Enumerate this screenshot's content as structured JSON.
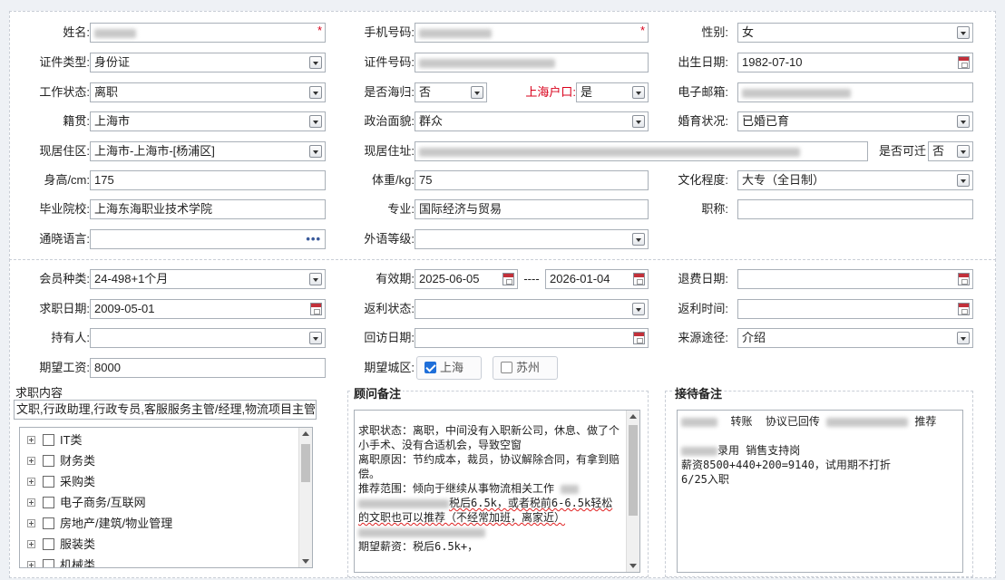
{
  "basic": {
    "name": {
      "label": "姓名:",
      "value": ""
    },
    "phone": {
      "label": "手机号码:",
      "value": ""
    },
    "gender": {
      "label": "性别:",
      "value": "女"
    },
    "id_type": {
      "label": "证件类型:",
      "value": "身份证"
    },
    "id_no": {
      "label": "证件号码:",
      "value": ""
    },
    "birth": {
      "label": "出生日期:",
      "value": "1982-07-10"
    },
    "work_status": {
      "label": "工作状态:",
      "value": "离职"
    },
    "overseas": {
      "label": "是否海归:",
      "value": "否"
    },
    "hukou": {
      "label": "上海户口:",
      "value": "是"
    },
    "email": {
      "label": "电子邮箱:",
      "value": ""
    },
    "native": {
      "label": "籍贯:",
      "value": "上海市"
    },
    "politics": {
      "label": "政治面貌:",
      "value": "群众"
    },
    "marital": {
      "label": "婚育状况:",
      "value": "已婚已育"
    },
    "residence": {
      "label": "现居住区:",
      "value": "上海市-上海市-[杨浦区]"
    },
    "address": {
      "label": "现居住址:",
      "value": ""
    },
    "relocate": {
      "label": "是否可迁",
      "value": "否"
    },
    "height": {
      "label": "身高/cm:",
      "value": "175"
    },
    "weight": {
      "label": "体重/kg:",
      "value": "75"
    },
    "education": {
      "label": "文化程度:",
      "value": "大专（全日制）"
    },
    "school": {
      "label": "毕业院校:",
      "value": "上海东海职业技术学院"
    },
    "major": {
      "label": "专业:",
      "value": "国际经济与贸易"
    },
    "title": {
      "label": "职称:",
      "value": ""
    },
    "language": {
      "label": "通晓语言:",
      "value": "",
      "more": "•••"
    },
    "foreign_level": {
      "label": "外语等级:",
      "value": ""
    }
  },
  "member": {
    "type": {
      "label": "会员种类:",
      "value": "24-498+1个月"
    },
    "valid": {
      "label": "有效期:",
      "start": "2025-06-05",
      "sep": "----",
      "end": "2026-01-04"
    },
    "refund_date": {
      "label": "退费日期:",
      "value": ""
    },
    "job_date": {
      "label": "求职日期:",
      "value": "2009-05-01"
    },
    "rebate_status": {
      "label": "返利状态:",
      "value": ""
    },
    "rebate_time": {
      "label": "返利时间:",
      "value": ""
    },
    "holder": {
      "label": "持有人:",
      "value": ""
    },
    "visit_date": {
      "label": "回访日期:",
      "value": ""
    },
    "source": {
      "label": "来源途径:",
      "value": "介绍"
    },
    "salary": {
      "label": "期望工资:",
      "value": "8000"
    },
    "city": {
      "label": "期望城区:",
      "options": [
        {
          "label": "上海",
          "checked": true
        },
        {
          "label": "苏州",
          "checked": false
        }
      ]
    }
  },
  "job_content": {
    "title": "求职内容",
    "summary": "文职,行政助理,行政专员,客服服务主管/经理,物流项目主管",
    "tree": [
      "IT类",
      "财务类",
      "采购类",
      "电子商务/互联网",
      "房地产/建筑/物业管理",
      "服装类",
      "机械类"
    ]
  },
  "advisor_note": {
    "title": "顾问备注",
    "lines": [
      "求职状态：离职，中间没有入职新公司，休息、做了个小手术、没有合适机会，导致空窗",
      "离职原因：节约成本，裁员，协议解除合同，有拿到赔偿。",
      "推荐范围：倾向于继续从事物流相关工作",
      "税后6.5k，或者税前6-6.5k轻松的文职也可以推荐（不经常加班，离家近）",
      "期望薪资：税后6.5k+，"
    ]
  },
  "reception_note": {
    "title": "接待备注",
    "l1a": "转账",
    "l1b": "协议已回传",
    "l1c": "推荐",
    "l2": "录用 销售支持岗",
    "l3": "薪资8500+440+200=9140，试用期不打折",
    "l4": "6/25入职"
  },
  "colors": {
    "required": "#d9001b",
    "checked": "#1f6fd9",
    "label_red": "#d9001b"
  }
}
